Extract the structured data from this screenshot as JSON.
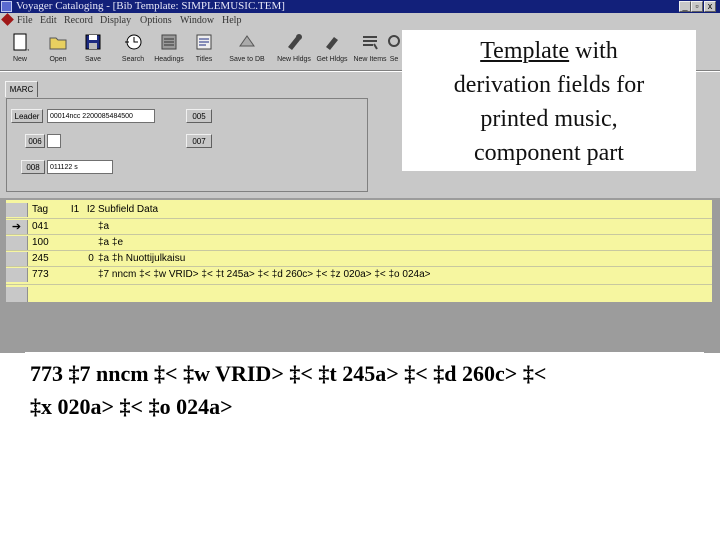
{
  "window": {
    "title": "Voyager Cataloging - [Bib Template: SIMPLEMUSIC.TEM]",
    "buttons": [
      "_",
      "x"
    ]
  },
  "menu": [
    "File",
    "Edit",
    "Record",
    "Display",
    "Options",
    "Window",
    "Help"
  ],
  "toolbar": [
    {
      "label": "New",
      "icon": "new-document-icon"
    },
    {
      "label": "Open",
      "icon": "folder-icon"
    },
    {
      "label": "Save",
      "icon": "floppy-disk-icon"
    },
    {
      "label": "Search",
      "icon": "search-clock-icon"
    },
    {
      "label": "Headings",
      "icon": "headings-icon"
    },
    {
      "label": "Titles",
      "icon": "titles-icon"
    },
    {
      "label": "Save to DB",
      "icon": "save-db-icon"
    },
    {
      "label": "New Hldgs",
      "icon": "new-holdings-icon"
    },
    {
      "label": "Get Hldgs",
      "icon": "get-holdings-icon"
    },
    {
      "label": "New Items",
      "icon": "new-items-icon"
    },
    {
      "label": "Se",
      "icon": "search-icon"
    }
  ],
  "marc": {
    "tab": "MARC",
    "leader_label": "Leader",
    "leader_value": "00014ncc  2200085484500",
    "f005_label": "005",
    "f006_label": "006",
    "f007_label": "007",
    "f008_label": "008",
    "f008_value": "011122 s"
  },
  "grid": {
    "headers": {
      "tag": "Tag",
      "i1": "I1",
      "i2": "I2",
      "data": "Subfield Data"
    },
    "rows": [
      {
        "tag": "041",
        "i1": "",
        "i2": "",
        "data": "‡a",
        "current": "➔"
      },
      {
        "tag": "100",
        "i1": "",
        "i2": "",
        "data": "‡a  ‡e",
        "current": ""
      },
      {
        "tag": "245",
        "i1": "",
        "i2": "0",
        "data": "‡a  ‡h Nuottijulkaisu",
        "current": ""
      },
      {
        "tag": "773",
        "i1": "",
        "i2": "",
        "data": "‡7 nncm ‡<  ‡w VRID> ‡<  ‡t 245a> ‡<  ‡d 260c> ‡<  ‡z 020a> ‡<  ‡o 024a>",
        "current": ""
      }
    ]
  },
  "callout": {
    "underlined": "Template",
    "line1_rest": " with",
    "line2": "derivation fields for",
    "line3": "printed music,",
    "line4": "component part"
  },
  "field773": {
    "line1": "773 ‡7 nncm ‡< ‡w VRID> ‡< ‡t 245a> ‡< ‡d 260c> ‡<",
    "line2": "‡x 020a> ‡<  ‡o 024a>"
  }
}
